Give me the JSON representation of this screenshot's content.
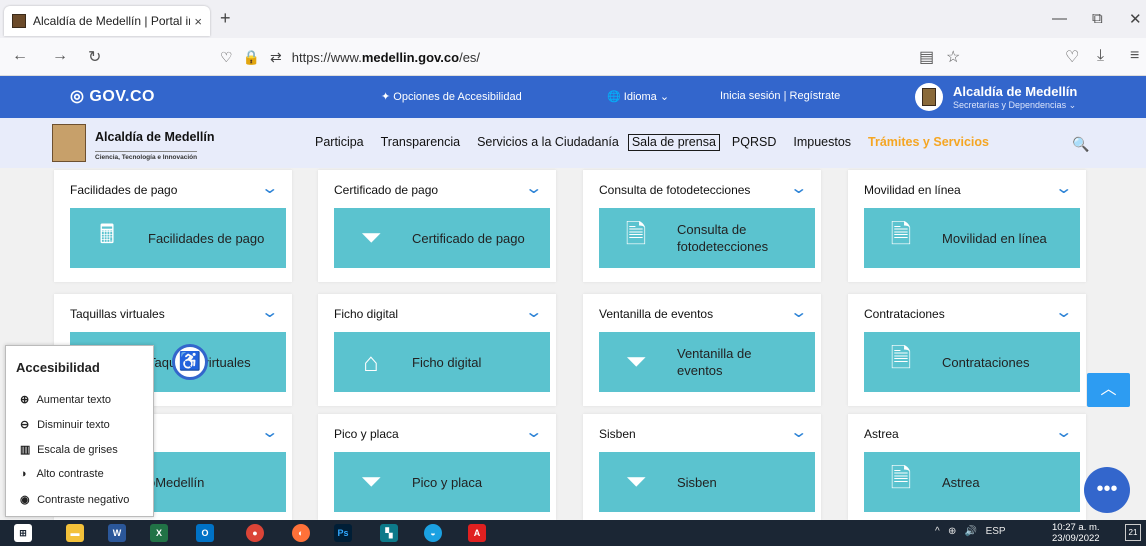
{
  "browser": {
    "tab_title": "Alcaldía de Medellín | Portal ins…",
    "tab_close": "×",
    "new_tab": "+",
    "url_prefix": "https://www.",
    "url_domain": "medellin.gov.co",
    "url_path": "/es/",
    "minimize": "—",
    "restore": "⧉",
    "close": "✕"
  },
  "gov_bar": {
    "logo": "GOV.CO",
    "accessibility_options": "Opciones de Accesibilidad",
    "language": "Idioma",
    "login": "Inicia sesión  |  Regístrate",
    "alcaldia_name": "Alcaldía de Medellín",
    "alcaldia_sub": "Secretarías y Dependencias"
  },
  "site_header": {
    "org_name": "Alcaldía de Medellín",
    "org_sub": "Ciencia, Tecnología e Innovación",
    "nav": [
      "Participa",
      "Transparencia",
      "Servicios a la Ciudadanía",
      "Sala de prensa",
      "PQRSD",
      "Impuestos",
      "Trámites y Servicios"
    ]
  },
  "cards": [
    {
      "header": "Facilidades de pago",
      "tile": "Facilidades de pago",
      "icon": "cash-register-icon"
    },
    {
      "header": "Certificado de pago",
      "tile": "Certificado de pago",
      "icon": "double-chevron-icon"
    },
    {
      "header": "Consulta de fotodetecciones",
      "tile": "Consulta de fotodetecciones",
      "icon": "document-icon"
    },
    {
      "header": "Movilidad en línea",
      "tile": "Movilidad en línea",
      "icon": "document-icon"
    },
    {
      "header": "Taquillas virtuales",
      "tile": "Taquillas virtuales",
      "icon": "ticket-icon"
    },
    {
      "header": "Ficho digital",
      "tile": "Ficho digital",
      "icon": "house-icon"
    },
    {
      "header": "Ventanilla de eventos",
      "tile": "Ventanilla de eventos",
      "icon": "double-chevron-icon"
    },
    {
      "header": "Contrataciones",
      "tile": "Contrataciones",
      "icon": "document-icon"
    },
    {
      "header": "",
      "tile": "oMedellín",
      "icon": "app-icon"
    },
    {
      "header": "Pico y placa",
      "tile": "Pico y placa",
      "icon": "double-chevron-icon"
    },
    {
      "header": "Sisben",
      "tile": "Sisben",
      "icon": "double-chevron-icon"
    },
    {
      "header": "Astrea",
      "tile": "Astrea",
      "icon": "document-icon"
    }
  ],
  "accessibility_panel": {
    "title": "Accesibilidad",
    "options": [
      "Aumentar texto",
      "Disminuir texto",
      "Escala de grises",
      "Alto contraste",
      "Contraste negativo"
    ]
  },
  "taskbar": {
    "language": "ESP",
    "time": "10:27 a. m.",
    "date": "23/09/2022",
    "notifications": "21"
  }
}
